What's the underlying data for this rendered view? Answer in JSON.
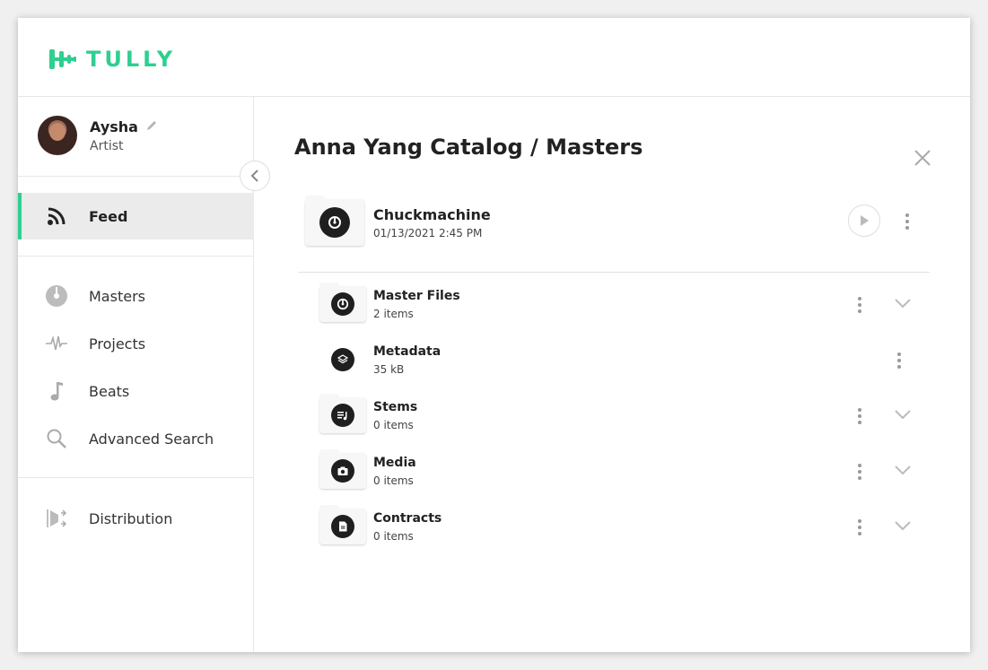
{
  "app": {
    "logo_text": "TULLY",
    "accent": "#2fcf8f"
  },
  "profile": {
    "name": "Aysha",
    "role": "Artist"
  },
  "sidebar": {
    "items": [
      {
        "label": "Feed",
        "icon": "rss-icon",
        "active": true
      },
      {
        "label": "Masters",
        "icon": "disc-icon"
      },
      {
        "label": "Projects",
        "icon": "waveform-icon"
      },
      {
        "label": "Beats",
        "icon": "music-note-icon"
      },
      {
        "label": "Advanced Search",
        "icon": "search-icon"
      },
      {
        "label": "Distribution",
        "icon": "distribution-icon"
      }
    ]
  },
  "main": {
    "title": "Anna Yang Catalog / Masters",
    "master": {
      "name": "Chuckmachine",
      "date": "01/13/2021 2:45 PM"
    },
    "children": [
      {
        "name": "Master Files",
        "sub": "2 items",
        "icon": "disc-icon",
        "folder": true,
        "expandable": true
      },
      {
        "name": "Metadata",
        "sub": "35 kB",
        "icon": "layers-icon",
        "folder": false,
        "expandable": false
      },
      {
        "name": "Stems",
        "sub": "0 items",
        "icon": "playlist-icon",
        "folder": true,
        "expandable": true
      },
      {
        "name": "Media",
        "sub": "0 items",
        "icon": "camera-icon",
        "folder": true,
        "expandable": true
      },
      {
        "name": "Contracts",
        "sub": "0 items",
        "icon": "document-icon",
        "folder": true,
        "expandable": true
      }
    ]
  }
}
